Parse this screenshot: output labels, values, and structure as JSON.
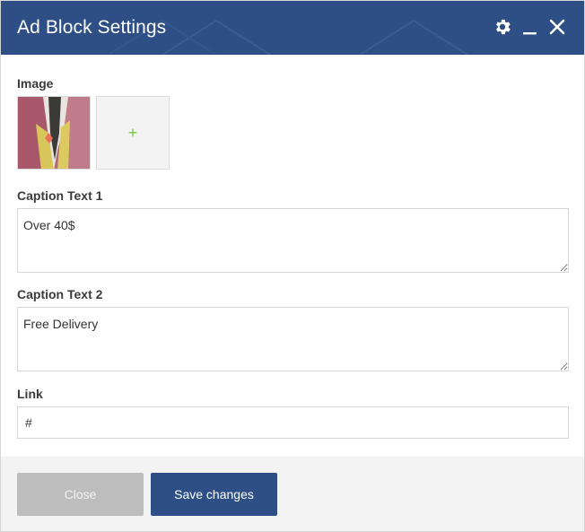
{
  "dialog": {
    "title": "Ad Block Settings",
    "header_color": "#2e4f86",
    "controls": [
      "gear-icon",
      "minimize-icon",
      "close-icon"
    ]
  },
  "image": {
    "label": "Image",
    "add_symbol": "+",
    "thumbnail_icon": "clothing-photo"
  },
  "caption1": {
    "label": "Caption Text 1",
    "value": "Over 40$"
  },
  "caption2": {
    "label": "Caption Text 2",
    "value": "Free Delivery"
  },
  "link": {
    "label": "Link",
    "value": "#"
  },
  "footer": {
    "close_label": "Close",
    "save_label": "Save changes",
    "save_color": "#2e4f86",
    "close_color": "#bdbdbd"
  }
}
